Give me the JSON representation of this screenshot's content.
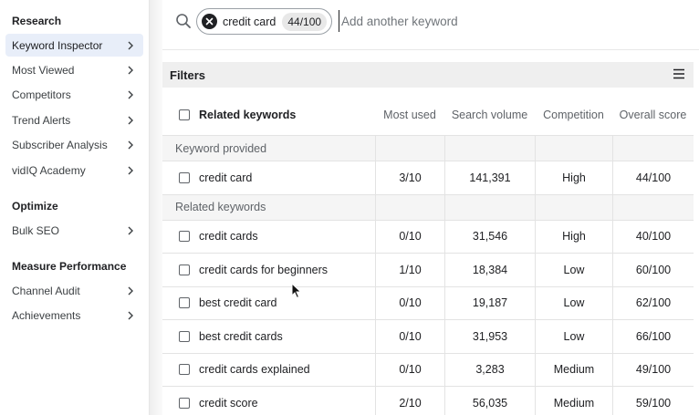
{
  "sidebar": {
    "sections": [
      {
        "heading": "Research",
        "items": [
          {
            "label": "Keyword Inspector",
            "active": true
          },
          {
            "label": "Most Viewed"
          },
          {
            "label": "Competitors"
          },
          {
            "label": "Trend Alerts"
          },
          {
            "label": "Subscriber Analysis"
          },
          {
            "label": "vidIQ Academy"
          }
        ]
      },
      {
        "heading": "Optimize",
        "items": [
          {
            "label": "Bulk SEO"
          }
        ]
      },
      {
        "heading": "Measure Performance",
        "items": [
          {
            "label": "Channel Audit"
          },
          {
            "label": "Achievements"
          }
        ]
      }
    ]
  },
  "search": {
    "icon": "search-icon",
    "chip": {
      "label": "credit card",
      "score": "44/100",
      "close_icon": "close-icon"
    },
    "placeholder": "Add another keyword"
  },
  "filters": {
    "title": "Filters",
    "menu_icon": "filter-menu-icon"
  },
  "table": {
    "headers": {
      "keyword": "Related keywords",
      "most_used": "Most used",
      "search_volume": "Search volume",
      "competition": "Competition",
      "overall_score": "Overall score"
    },
    "groups": [
      {
        "label": "Keyword provided",
        "rows": [
          {
            "keyword": "credit card",
            "most_used": "3/10",
            "search_volume": "141,391",
            "competition": "High",
            "overall_score": "44/100"
          }
        ]
      },
      {
        "label": "Related keywords",
        "rows": [
          {
            "keyword": "credit cards",
            "most_used": "0/10",
            "search_volume": "31,546",
            "competition": "High",
            "overall_score": "40/100"
          },
          {
            "keyword": "credit cards for beginners",
            "most_used": "1/10",
            "search_volume": "18,384",
            "competition": "Low",
            "overall_score": "60/100"
          },
          {
            "keyword": "best credit card",
            "most_used": "0/10",
            "search_volume": "19,187",
            "competition": "Low",
            "overall_score": "62/100"
          },
          {
            "keyword": "best credit cards",
            "most_used": "0/10",
            "search_volume": "31,953",
            "competition": "Low",
            "overall_score": "66/100"
          },
          {
            "keyword": "credit cards explained",
            "most_used": "0/10",
            "search_volume": "3,283",
            "competition": "Medium",
            "overall_score": "49/100"
          },
          {
            "keyword": "credit score",
            "most_used": "2/10",
            "search_volume": "56,035",
            "competition": "Medium",
            "overall_score": "59/100"
          }
        ]
      }
    ]
  },
  "colors": {
    "active_item_bg": "#e8eef9",
    "filters_bar_bg": "#efefef",
    "group_row_bg": "#f5f5f5"
  }
}
